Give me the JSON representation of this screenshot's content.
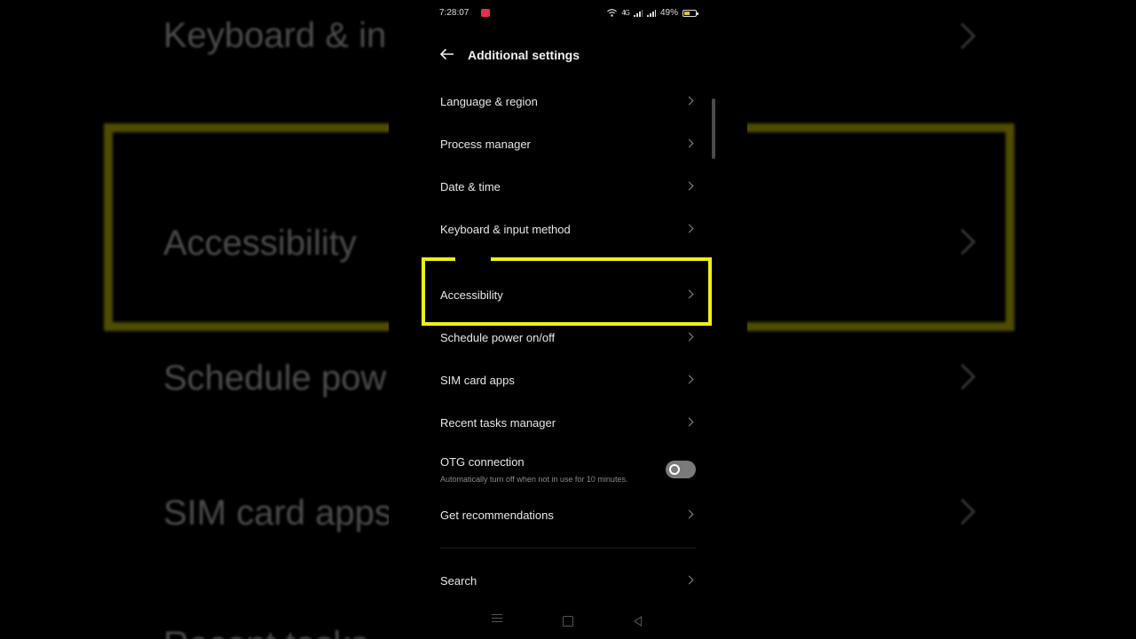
{
  "status_bar": {
    "time": "7:28:07",
    "network": "4G",
    "battery": "49%",
    "battery_level": 0.49
  },
  "header": {
    "title": "Additional settings",
    "back_icon": "arrow-left-icon"
  },
  "items": [
    {
      "label": "Language & region"
    },
    {
      "label": "Process manager"
    },
    {
      "label": "Date & time"
    },
    {
      "label": "Keyboard & input method"
    },
    {
      "label": "Accessibility"
    },
    {
      "label": "Schedule power on/off"
    },
    {
      "label": "SIM card apps"
    },
    {
      "label": "Recent tasks manager"
    },
    {
      "label": "OTG connection",
      "sublabel": "Automatically turn off when not in use for 10 minutes.",
      "toggle_on": false
    },
    {
      "label": "Get recommendations"
    },
    {
      "label": "Search"
    }
  ],
  "highlight_color": "#f4ef12",
  "background_zoom": {
    "labels": [
      "Keyboard & in",
      "Accessibility",
      "Schedule pow",
      "SIM card apps",
      "Recent tasks"
    ]
  },
  "nav_bar": {
    "icons": [
      "menu-icon",
      "home-icon",
      "back-triangle-icon"
    ]
  }
}
